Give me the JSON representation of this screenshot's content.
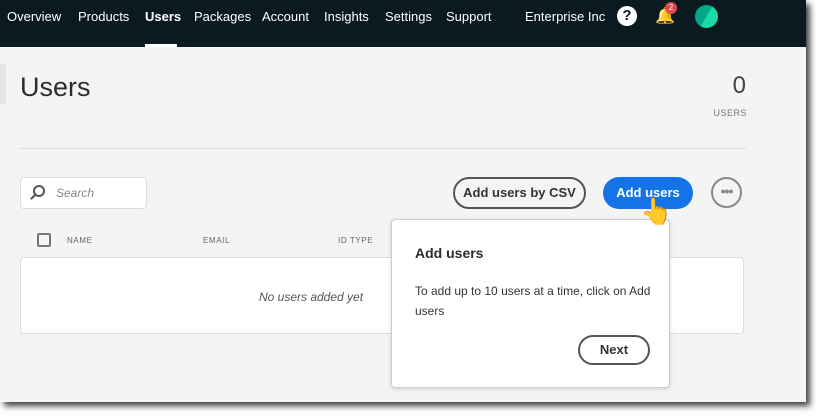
{
  "nav": {
    "items": [
      "Overview",
      "Products",
      "Users",
      "Packages",
      "Account",
      "Insights",
      "Settings",
      "Support"
    ],
    "active": "Users",
    "org": "Enterprise Inc",
    "notifications": "2",
    "help": "?"
  },
  "page": {
    "title": "Users",
    "count": "0",
    "count_label": "USERS"
  },
  "toolbar": {
    "search_placeholder": "Search",
    "csv_label": "Add users by CSV",
    "add_label": "Add users",
    "more": "•••"
  },
  "table": {
    "headers": [
      "NAME",
      "EMAIL",
      "ID TYPE"
    ],
    "empty": "No users added yet"
  },
  "popover": {
    "title": "Add users",
    "body": "To add up to 10 users at a time, click on Add users",
    "next": "Next"
  },
  "colors": {
    "nav": "#0b1a21",
    "accent": "#1473e6"
  }
}
